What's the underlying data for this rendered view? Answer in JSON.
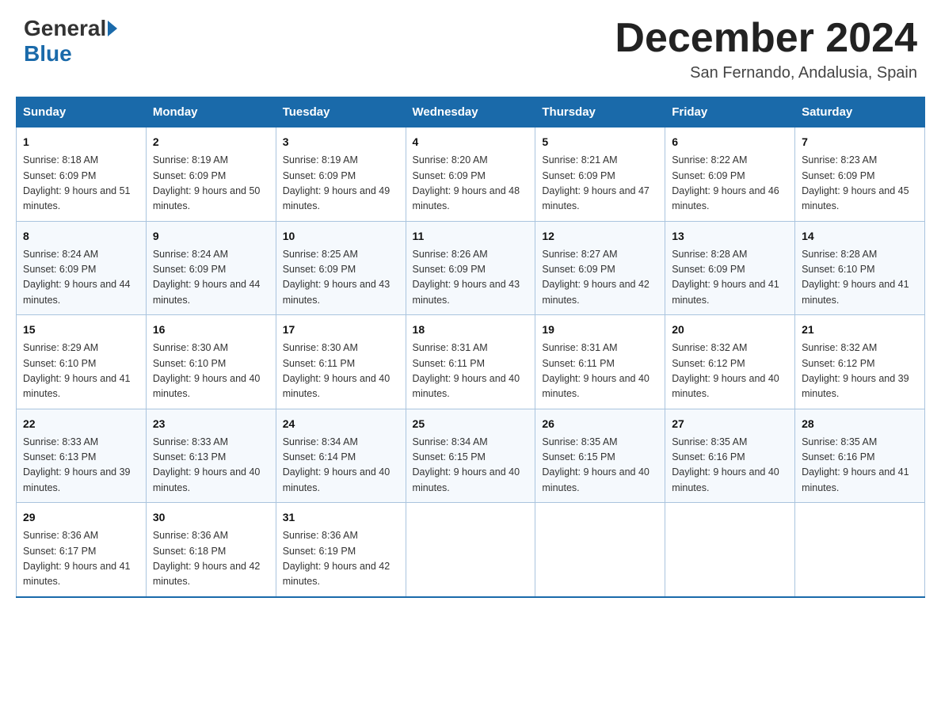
{
  "header": {
    "logo_general": "General",
    "logo_blue": "Blue",
    "month_title": "December 2024",
    "location": "San Fernando, Andalusia, Spain"
  },
  "weekdays": [
    "Sunday",
    "Monday",
    "Tuesday",
    "Wednesday",
    "Thursday",
    "Friday",
    "Saturday"
  ],
  "weeks": [
    [
      {
        "day": "1",
        "sunrise": "8:18 AM",
        "sunset": "6:09 PM",
        "daylight": "9 hours and 51 minutes."
      },
      {
        "day": "2",
        "sunrise": "8:19 AM",
        "sunset": "6:09 PM",
        "daylight": "9 hours and 50 minutes."
      },
      {
        "day": "3",
        "sunrise": "8:19 AM",
        "sunset": "6:09 PM",
        "daylight": "9 hours and 49 minutes."
      },
      {
        "day": "4",
        "sunrise": "8:20 AM",
        "sunset": "6:09 PM",
        "daylight": "9 hours and 48 minutes."
      },
      {
        "day": "5",
        "sunrise": "8:21 AM",
        "sunset": "6:09 PM",
        "daylight": "9 hours and 47 minutes."
      },
      {
        "day": "6",
        "sunrise": "8:22 AM",
        "sunset": "6:09 PM",
        "daylight": "9 hours and 46 minutes."
      },
      {
        "day": "7",
        "sunrise": "8:23 AM",
        "sunset": "6:09 PM",
        "daylight": "9 hours and 45 minutes."
      }
    ],
    [
      {
        "day": "8",
        "sunrise": "8:24 AM",
        "sunset": "6:09 PM",
        "daylight": "9 hours and 44 minutes."
      },
      {
        "day": "9",
        "sunrise": "8:24 AM",
        "sunset": "6:09 PM",
        "daylight": "9 hours and 44 minutes."
      },
      {
        "day": "10",
        "sunrise": "8:25 AM",
        "sunset": "6:09 PM",
        "daylight": "9 hours and 43 minutes."
      },
      {
        "day": "11",
        "sunrise": "8:26 AM",
        "sunset": "6:09 PM",
        "daylight": "9 hours and 43 minutes."
      },
      {
        "day": "12",
        "sunrise": "8:27 AM",
        "sunset": "6:09 PM",
        "daylight": "9 hours and 42 minutes."
      },
      {
        "day": "13",
        "sunrise": "8:28 AM",
        "sunset": "6:09 PM",
        "daylight": "9 hours and 41 minutes."
      },
      {
        "day": "14",
        "sunrise": "8:28 AM",
        "sunset": "6:10 PM",
        "daylight": "9 hours and 41 minutes."
      }
    ],
    [
      {
        "day": "15",
        "sunrise": "8:29 AM",
        "sunset": "6:10 PM",
        "daylight": "9 hours and 41 minutes."
      },
      {
        "day": "16",
        "sunrise": "8:30 AM",
        "sunset": "6:10 PM",
        "daylight": "9 hours and 40 minutes."
      },
      {
        "day": "17",
        "sunrise": "8:30 AM",
        "sunset": "6:11 PM",
        "daylight": "9 hours and 40 minutes."
      },
      {
        "day": "18",
        "sunrise": "8:31 AM",
        "sunset": "6:11 PM",
        "daylight": "9 hours and 40 minutes."
      },
      {
        "day": "19",
        "sunrise": "8:31 AM",
        "sunset": "6:11 PM",
        "daylight": "9 hours and 40 minutes."
      },
      {
        "day": "20",
        "sunrise": "8:32 AM",
        "sunset": "6:12 PM",
        "daylight": "9 hours and 40 minutes."
      },
      {
        "day": "21",
        "sunrise": "8:32 AM",
        "sunset": "6:12 PM",
        "daylight": "9 hours and 39 minutes."
      }
    ],
    [
      {
        "day": "22",
        "sunrise": "8:33 AM",
        "sunset": "6:13 PM",
        "daylight": "9 hours and 39 minutes."
      },
      {
        "day": "23",
        "sunrise": "8:33 AM",
        "sunset": "6:13 PM",
        "daylight": "9 hours and 40 minutes."
      },
      {
        "day": "24",
        "sunrise": "8:34 AM",
        "sunset": "6:14 PM",
        "daylight": "9 hours and 40 minutes."
      },
      {
        "day": "25",
        "sunrise": "8:34 AM",
        "sunset": "6:15 PM",
        "daylight": "9 hours and 40 minutes."
      },
      {
        "day": "26",
        "sunrise": "8:35 AM",
        "sunset": "6:15 PM",
        "daylight": "9 hours and 40 minutes."
      },
      {
        "day": "27",
        "sunrise": "8:35 AM",
        "sunset": "6:16 PM",
        "daylight": "9 hours and 40 minutes."
      },
      {
        "day": "28",
        "sunrise": "8:35 AM",
        "sunset": "6:16 PM",
        "daylight": "9 hours and 41 minutes."
      }
    ],
    [
      {
        "day": "29",
        "sunrise": "8:36 AM",
        "sunset": "6:17 PM",
        "daylight": "9 hours and 41 minutes."
      },
      {
        "day": "30",
        "sunrise": "8:36 AM",
        "sunset": "6:18 PM",
        "daylight": "9 hours and 42 minutes."
      },
      {
        "day": "31",
        "sunrise": "8:36 AM",
        "sunset": "6:19 PM",
        "daylight": "9 hours and 42 minutes."
      },
      null,
      null,
      null,
      null
    ]
  ]
}
